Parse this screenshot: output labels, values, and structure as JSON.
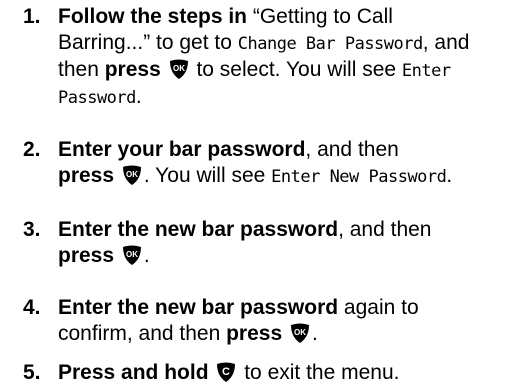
{
  "steps": [
    {
      "number": "1.",
      "line1_bold": "Follow the steps in",
      "line1_rest": " “Getting to Call",
      "line2_a": "Barring...” to get to ",
      "line2_lcd": "Change Bar Password",
      "line2_b": ", and",
      "line3_a": "then ",
      "line3_bold": "press",
      "line3_b": " to select. You will see ",
      "line3_lcd": "Enter",
      "line4_lcd": "Password",
      "line4_end": "."
    },
    {
      "number": "2.",
      "line1_bold": "Enter your bar password",
      "line1_rest": ", and then",
      "line2_bold": "press",
      "line2_a": ". You will see ",
      "line2_lcd": "Enter New Password",
      "line2_end": "."
    },
    {
      "number": "3.",
      "line1_bold": "Enter the new bar password",
      "line1_rest": ", and then",
      "line2_bold": "press",
      "line2_end": "."
    },
    {
      "number": "4.",
      "line1_bold": "Enter the new bar password",
      "line1_rest": " again to",
      "line2_a": "confirm, and then ",
      "line2_bold": "press",
      "line2_end": "."
    },
    {
      "number": "5.",
      "line1_bold": "Press and hold",
      "line1_rest": " to exit the menu."
    }
  ],
  "icons": {
    "ok_key": {
      "name": "ok-key-icon",
      "glyph": "OK",
      "color": "#000000"
    },
    "clear_key": {
      "name": "clear-key-icon",
      "glyph": "C",
      "color": "#000000"
    }
  }
}
